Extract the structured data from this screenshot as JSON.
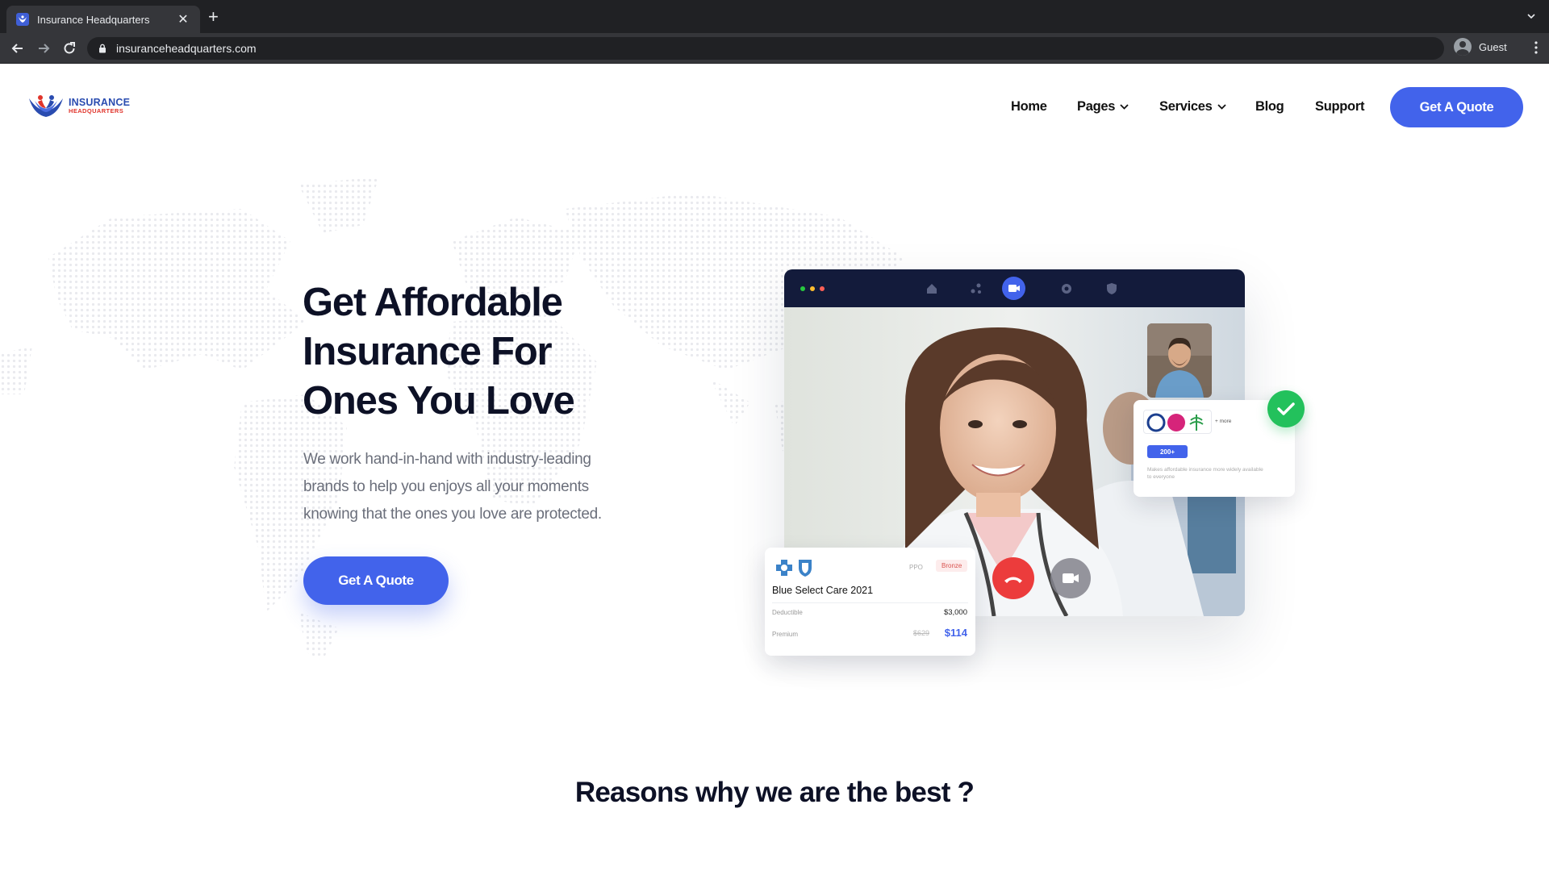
{
  "browser": {
    "tab_title": "Insurance Headquarters",
    "url": "insuranceheadquarters.com",
    "profile_label": "Guest",
    "icons": [
      "close-icon",
      "plus-icon",
      "back-arrow-icon",
      "forward-arrow-icon",
      "reload-icon",
      "lock-icon",
      "profile-icon",
      "kebab-menu-icon",
      "tab-search-icon"
    ]
  },
  "logo": {
    "line1": "INSURANCE",
    "line2": "HEADQUARTERS"
  },
  "nav": {
    "items": [
      {
        "label": "Home"
      },
      {
        "label": "Pages",
        "dropdown": true
      },
      {
        "label": "Services",
        "dropdown": true
      },
      {
        "label": "Blog"
      },
      {
        "label": "Support"
      }
    ],
    "cta_label": "Get A Quote"
  },
  "hero": {
    "title_lines": [
      "Get Affordable",
      "Insurance For",
      "Ones You Love"
    ],
    "description": "We work hand-in-hand with industry-leading brands to help you enjoys all your moments knowing that the ones you love are protected.",
    "cta_label": "Get A Quote"
  },
  "mockup": {
    "carriers": {
      "more_label": "+ more",
      "count_badge": "200+",
      "note": "Makes affordable insurance more widely available to everyone"
    },
    "plan": {
      "type": "PPO",
      "tier": "Bronze",
      "name": "Blue Select Care 2021",
      "deductible_label": "Deductible",
      "deductible_value": "$3,000",
      "premium_label": "Premium",
      "premium_old": "$629",
      "premium_new": "$114"
    }
  },
  "reasons": {
    "title": "Reasons why we are the best ?"
  },
  "colors": {
    "accent": "#4263eb",
    "navy": "#131b3b",
    "success": "#23c15c",
    "danger": "#ec3c3c",
    "browser_dark": "#202124",
    "browser_tab": "#35363a"
  }
}
